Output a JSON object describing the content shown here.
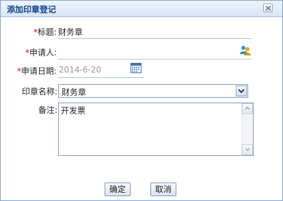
{
  "dialog": {
    "title": "添加印章登记",
    "close_icon": "close-icon"
  },
  "form": {
    "required_mark": "*",
    "title_label": "标题:",
    "title_value": "财务章",
    "applicant_label": "申请人:",
    "applicant_value": "",
    "applicant_icon": "user-picker-icon",
    "date_label": "申请日期:",
    "date_value": "2014-6-20",
    "date_icon": "calendar-icon",
    "seal_name_label": "印章名称:",
    "seal_name_selected": "财务章",
    "remark_label": "备注:",
    "remark_value": "开发票"
  },
  "buttons": {
    "ok_label": "确定",
    "cancel_label": "取消"
  },
  "colors": {
    "title_text": "#15428b",
    "required": "#e00000",
    "field_line": "#a7c3e2",
    "date_text": "#9a9a9a"
  }
}
